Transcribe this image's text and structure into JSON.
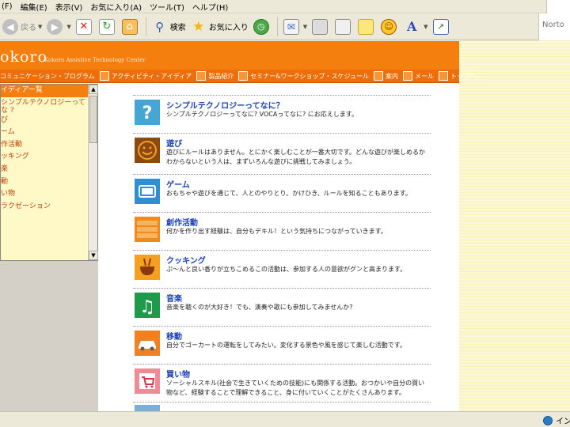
{
  "menubar": {
    "items": [
      "(F)",
      "編集(E)",
      "表示(V)",
      "お気に入り(A)",
      "ツール(T)",
      "ヘルプ(H)"
    ]
  },
  "toolbar": {
    "back_label": "戻る",
    "search_label": "検索",
    "favorites_label": "お気に入り",
    "norton_label": "Norto"
  },
  "site": {
    "logo": "okoro",
    "subtitle": "Kokoro Assistive Technology Center",
    "nav": [
      "コミュニケーション・プログラム",
      "アクティビティ・アイディア",
      "製品紹介",
      "セミナー&ワークショップ・スケジュール",
      "案内",
      "メール",
      "トップへ"
    ]
  },
  "sidebar": {
    "items": [
      "イディアー覧",
      "シンプルテクノロジーってな ?",
      "び",
      "ーム",
      "作活動",
      "ッキング",
      "楽",
      "動",
      "い物",
      "ラクゼーション"
    ]
  },
  "activities": [
    {
      "title": "シンプルテクノロジーってなに？",
      "desc": "シンプルテクノロジーってなに? VOCAってなに? にお応えします。",
      "color": "#45a6d4",
      "icon": "question-icon"
    },
    {
      "title": "遊び",
      "desc": "遊びにルールはありません。とにかく楽しむことが一番大切です。どんな遊びが楽しめるかわからないという人は、まずいろんな遊びに挑戦してみましょう。",
      "color": "#8a4a12",
      "icon": "smiley-icon"
    },
    {
      "title": "ゲーム",
      "desc": "おもちゃや遊びを通じて、人とのやりとり、かけひき、ルールを知ることもあります。",
      "color": "#2f8fd4",
      "icon": "tv-icon"
    },
    {
      "title": "創作活動",
      "desc": "何かを作り出す経験は、自分もデキル！という気持ちにつながっていきます。",
      "color": "#f08a1a",
      "icon": "creation-icon"
    },
    {
      "title": "クッキング",
      "desc": "ぷ～んと良い香りが立ちこめるこの活動は、参加する人の意欲がグンと高まります。",
      "color": "#f5a020",
      "icon": "pot-icon"
    },
    {
      "title": "音楽",
      "desc": "音楽を聴くのが大好き！でも、演奏や歌にも参加してみませんか?",
      "color": "#1e9a4a",
      "icon": "music-note-icon"
    },
    {
      "title": "移動",
      "desc": "自分でゴーカートの運転をしてみたい。変化する景色や風を感じて楽しむ活動です。",
      "color": "#f08020",
      "icon": "car-icon"
    },
    {
      "title": "買い物",
      "desc": "ソーシャルスキル(社会で生きていくための技能)にも関係する活動。おつかいや自分の買い物など、経験することで理解できること、身に付いていくことがたくさんあります。",
      "color": "#f08a94",
      "icon": "cart-icon"
    }
  ],
  "statusbar": {
    "zone_label": "イン"
  }
}
